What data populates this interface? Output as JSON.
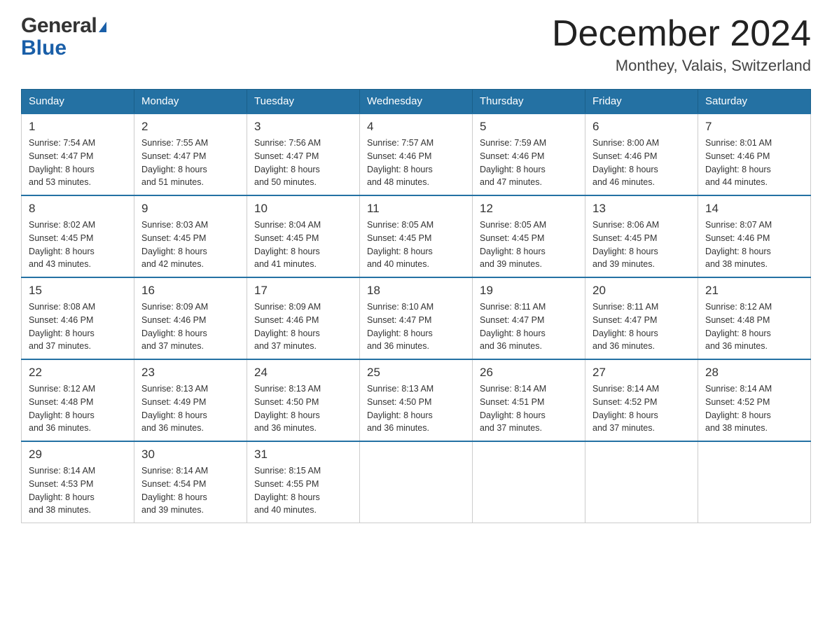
{
  "header": {
    "logo_general": "General",
    "logo_blue": "Blue",
    "month_title": "December 2024",
    "location": "Monthey, Valais, Switzerland"
  },
  "days_of_week": [
    "Sunday",
    "Monday",
    "Tuesday",
    "Wednesday",
    "Thursday",
    "Friday",
    "Saturday"
  ],
  "weeks": [
    [
      {
        "day": "1",
        "sunrise": "Sunrise: 7:54 AM",
        "sunset": "Sunset: 4:47 PM",
        "daylight": "Daylight: 8 hours",
        "daylight2": "and 53 minutes."
      },
      {
        "day": "2",
        "sunrise": "Sunrise: 7:55 AM",
        "sunset": "Sunset: 4:47 PM",
        "daylight": "Daylight: 8 hours",
        "daylight2": "and 51 minutes."
      },
      {
        "day": "3",
        "sunrise": "Sunrise: 7:56 AM",
        "sunset": "Sunset: 4:47 PM",
        "daylight": "Daylight: 8 hours",
        "daylight2": "and 50 minutes."
      },
      {
        "day": "4",
        "sunrise": "Sunrise: 7:57 AM",
        "sunset": "Sunset: 4:46 PM",
        "daylight": "Daylight: 8 hours",
        "daylight2": "and 48 minutes."
      },
      {
        "day": "5",
        "sunrise": "Sunrise: 7:59 AM",
        "sunset": "Sunset: 4:46 PM",
        "daylight": "Daylight: 8 hours",
        "daylight2": "and 47 minutes."
      },
      {
        "day": "6",
        "sunrise": "Sunrise: 8:00 AM",
        "sunset": "Sunset: 4:46 PM",
        "daylight": "Daylight: 8 hours",
        "daylight2": "and 46 minutes."
      },
      {
        "day": "7",
        "sunrise": "Sunrise: 8:01 AM",
        "sunset": "Sunset: 4:46 PM",
        "daylight": "Daylight: 8 hours",
        "daylight2": "and 44 minutes."
      }
    ],
    [
      {
        "day": "8",
        "sunrise": "Sunrise: 8:02 AM",
        "sunset": "Sunset: 4:45 PM",
        "daylight": "Daylight: 8 hours",
        "daylight2": "and 43 minutes."
      },
      {
        "day": "9",
        "sunrise": "Sunrise: 8:03 AM",
        "sunset": "Sunset: 4:45 PM",
        "daylight": "Daylight: 8 hours",
        "daylight2": "and 42 minutes."
      },
      {
        "day": "10",
        "sunrise": "Sunrise: 8:04 AM",
        "sunset": "Sunset: 4:45 PM",
        "daylight": "Daylight: 8 hours",
        "daylight2": "and 41 minutes."
      },
      {
        "day": "11",
        "sunrise": "Sunrise: 8:05 AM",
        "sunset": "Sunset: 4:45 PM",
        "daylight": "Daylight: 8 hours",
        "daylight2": "and 40 minutes."
      },
      {
        "day": "12",
        "sunrise": "Sunrise: 8:05 AM",
        "sunset": "Sunset: 4:45 PM",
        "daylight": "Daylight: 8 hours",
        "daylight2": "and 39 minutes."
      },
      {
        "day": "13",
        "sunrise": "Sunrise: 8:06 AM",
        "sunset": "Sunset: 4:45 PM",
        "daylight": "Daylight: 8 hours",
        "daylight2": "and 39 minutes."
      },
      {
        "day": "14",
        "sunrise": "Sunrise: 8:07 AM",
        "sunset": "Sunset: 4:46 PM",
        "daylight": "Daylight: 8 hours",
        "daylight2": "and 38 minutes."
      }
    ],
    [
      {
        "day": "15",
        "sunrise": "Sunrise: 8:08 AM",
        "sunset": "Sunset: 4:46 PM",
        "daylight": "Daylight: 8 hours",
        "daylight2": "and 37 minutes."
      },
      {
        "day": "16",
        "sunrise": "Sunrise: 8:09 AM",
        "sunset": "Sunset: 4:46 PM",
        "daylight": "Daylight: 8 hours",
        "daylight2": "and 37 minutes."
      },
      {
        "day": "17",
        "sunrise": "Sunrise: 8:09 AM",
        "sunset": "Sunset: 4:46 PM",
        "daylight": "Daylight: 8 hours",
        "daylight2": "and 37 minutes."
      },
      {
        "day": "18",
        "sunrise": "Sunrise: 8:10 AM",
        "sunset": "Sunset: 4:47 PM",
        "daylight": "Daylight: 8 hours",
        "daylight2": "and 36 minutes."
      },
      {
        "day": "19",
        "sunrise": "Sunrise: 8:11 AM",
        "sunset": "Sunset: 4:47 PM",
        "daylight": "Daylight: 8 hours",
        "daylight2": "and 36 minutes."
      },
      {
        "day": "20",
        "sunrise": "Sunrise: 8:11 AM",
        "sunset": "Sunset: 4:47 PM",
        "daylight": "Daylight: 8 hours",
        "daylight2": "and 36 minutes."
      },
      {
        "day": "21",
        "sunrise": "Sunrise: 8:12 AM",
        "sunset": "Sunset: 4:48 PM",
        "daylight": "Daylight: 8 hours",
        "daylight2": "and 36 minutes."
      }
    ],
    [
      {
        "day": "22",
        "sunrise": "Sunrise: 8:12 AM",
        "sunset": "Sunset: 4:48 PM",
        "daylight": "Daylight: 8 hours",
        "daylight2": "and 36 minutes."
      },
      {
        "day": "23",
        "sunrise": "Sunrise: 8:13 AM",
        "sunset": "Sunset: 4:49 PM",
        "daylight": "Daylight: 8 hours",
        "daylight2": "and 36 minutes."
      },
      {
        "day": "24",
        "sunrise": "Sunrise: 8:13 AM",
        "sunset": "Sunset: 4:50 PM",
        "daylight": "Daylight: 8 hours",
        "daylight2": "and 36 minutes."
      },
      {
        "day": "25",
        "sunrise": "Sunrise: 8:13 AM",
        "sunset": "Sunset: 4:50 PM",
        "daylight": "Daylight: 8 hours",
        "daylight2": "and 36 minutes."
      },
      {
        "day": "26",
        "sunrise": "Sunrise: 8:14 AM",
        "sunset": "Sunset: 4:51 PM",
        "daylight": "Daylight: 8 hours",
        "daylight2": "and 37 minutes."
      },
      {
        "day": "27",
        "sunrise": "Sunrise: 8:14 AM",
        "sunset": "Sunset: 4:52 PM",
        "daylight": "Daylight: 8 hours",
        "daylight2": "and 37 minutes."
      },
      {
        "day": "28",
        "sunrise": "Sunrise: 8:14 AM",
        "sunset": "Sunset: 4:52 PM",
        "daylight": "Daylight: 8 hours",
        "daylight2": "and 38 minutes."
      }
    ],
    [
      {
        "day": "29",
        "sunrise": "Sunrise: 8:14 AM",
        "sunset": "Sunset: 4:53 PM",
        "daylight": "Daylight: 8 hours",
        "daylight2": "and 38 minutes."
      },
      {
        "day": "30",
        "sunrise": "Sunrise: 8:14 AM",
        "sunset": "Sunset: 4:54 PM",
        "daylight": "Daylight: 8 hours",
        "daylight2": "and 39 minutes."
      },
      {
        "day": "31",
        "sunrise": "Sunrise: 8:15 AM",
        "sunset": "Sunset: 4:55 PM",
        "daylight": "Daylight: 8 hours",
        "daylight2": "and 40 minutes."
      },
      null,
      null,
      null,
      null
    ]
  ]
}
